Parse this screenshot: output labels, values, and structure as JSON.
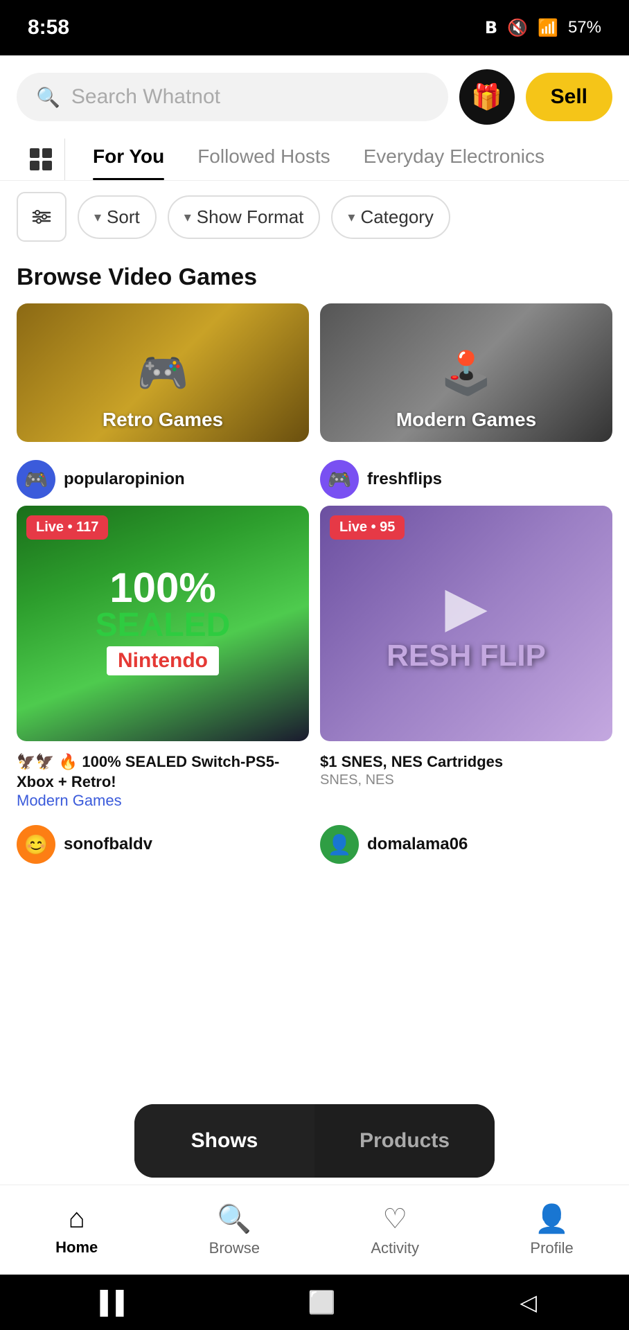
{
  "statusBar": {
    "time": "8:58",
    "battery": "57%"
  },
  "header": {
    "searchPlaceholder": "Search Whatnot",
    "sellLabel": "Sell"
  },
  "tabs": [
    {
      "id": "foryou",
      "label": "For You",
      "active": true
    },
    {
      "id": "followed",
      "label": "Followed Hosts",
      "active": false
    },
    {
      "id": "electronics",
      "label": "Everyday Electronics",
      "active": false
    }
  ],
  "filters": {
    "sortLabel": "Sort",
    "showFormatLabel": "Show Format",
    "categoryLabel": "Category"
  },
  "browseSection": {
    "title": "Browse Video Games",
    "categories": [
      {
        "id": "retro",
        "label": "Retro Games",
        "emoji": "🎮"
      },
      {
        "id": "modern",
        "label": "Modern Games",
        "emoji": "🕹️"
      }
    ]
  },
  "streams": [
    {
      "id": "popularopinion",
      "username": "popularopinion",
      "avatarEmoji": "🎮",
      "avatarColor": "blue",
      "liveLabel": "Live • 117",
      "title": "🦅🦅 🔥 100% SEALED Switch-PS5-Xbox + Retro!",
      "subtitle": "Modern Games",
      "thumbType": "sealed"
    },
    {
      "id": "freshflips",
      "username": "freshflips",
      "avatarEmoji": "🎮",
      "avatarColor": "purple",
      "liveLabel": "Live • 95",
      "title": "$1 SNES, NES Cartridges",
      "subtitle": "SNES, NES",
      "thumbType": "logo"
    }
  ],
  "bottomStreamers": [
    {
      "id": "sonofbaldv",
      "username": "sonofbaldv",
      "avatarEmoji": "😊",
      "avatarColor": "orange"
    },
    {
      "id": "domalama06",
      "username": "domalama06",
      "avatarEmoji": "👤",
      "avatarColor": "green"
    }
  ],
  "popup": {
    "showsLabel": "Shows",
    "productsLabel": "Products"
  },
  "bottomNav": [
    {
      "id": "home",
      "label": "Home",
      "icon": "⌂",
      "active": true
    },
    {
      "id": "browse",
      "label": "Browse",
      "icon": "🔍",
      "active": false
    },
    {
      "id": "activity",
      "label": "Activity",
      "icon": "♡",
      "active": false
    },
    {
      "id": "profile",
      "label": "Profile",
      "icon": "👤",
      "active": false
    }
  ]
}
